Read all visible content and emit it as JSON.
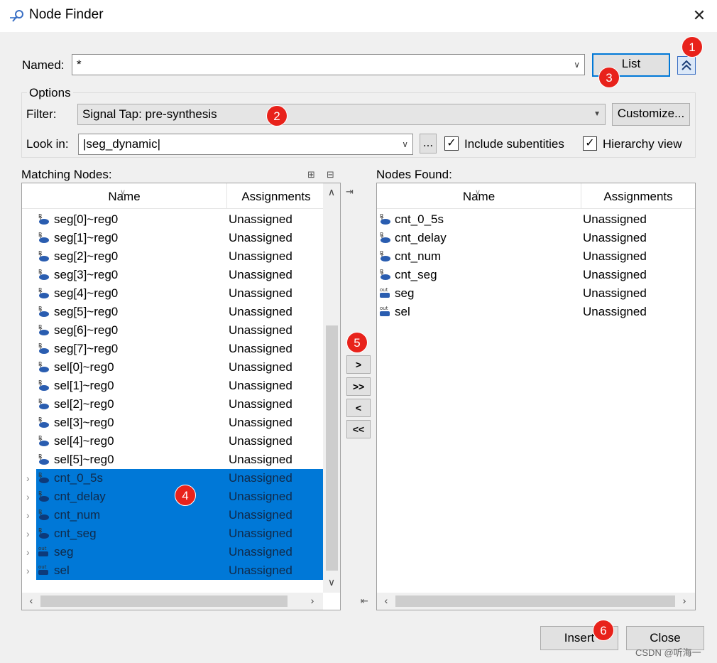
{
  "window": {
    "title": "Node Finder",
    "close_glyph": "✕"
  },
  "named": {
    "label": "Named:",
    "value": "*"
  },
  "list_button": "List",
  "options": {
    "group_label": "Options",
    "filter_label": "Filter:",
    "filter_value": "Signal Tap: pre-synthesis",
    "customize_button": "Customize...",
    "lookin_label": "Look in:",
    "lookin_value": "|seg_dynamic|",
    "browse_button": "...",
    "include_subentities_label": "Include subentities",
    "include_subentities_checked": true,
    "hierarchy_view_label": "Hierarchy view",
    "hierarchy_view_checked": true
  },
  "matching": {
    "title": "Matching Nodes:",
    "col_name": "Name",
    "col_assign": "Assignments",
    "rows": [
      {
        "name": "seg[0]~reg0",
        "assign": "Unassigned"
      },
      {
        "name": "seg[1]~reg0",
        "assign": "Unassigned"
      },
      {
        "name": "seg[2]~reg0",
        "assign": "Unassigned"
      },
      {
        "name": "seg[3]~reg0",
        "assign": "Unassigned"
      },
      {
        "name": "seg[4]~reg0",
        "assign": "Unassigned"
      },
      {
        "name": "seg[5]~reg0",
        "assign": "Unassigned"
      },
      {
        "name": "seg[6]~reg0",
        "assign": "Unassigned"
      },
      {
        "name": "seg[7]~reg0",
        "assign": "Unassigned"
      },
      {
        "name": "sel[0]~reg0",
        "assign": "Unassigned"
      },
      {
        "name": "sel[1]~reg0",
        "assign": "Unassigned"
      },
      {
        "name": "sel[2]~reg0",
        "assign": "Unassigned"
      },
      {
        "name": "sel[3]~reg0",
        "assign": "Unassigned"
      },
      {
        "name": "sel[4]~reg0",
        "assign": "Unassigned"
      },
      {
        "name": "sel[5]~reg0",
        "assign": "Unassigned"
      },
      {
        "name": "cnt_0_5s",
        "assign": "Unassigned"
      },
      {
        "name": "cnt_delay",
        "assign": "Unassigned"
      },
      {
        "name": "cnt_num",
        "assign": "Unassigned"
      },
      {
        "name": "cnt_seg",
        "assign": "Unassigned"
      },
      {
        "name": "seg",
        "assign": "Unassigned"
      },
      {
        "name": "sel",
        "assign": "Unassigned"
      }
    ]
  },
  "found": {
    "title": "Nodes Found:",
    "col_name": "Name",
    "col_assign": "Assignments",
    "rows": [
      {
        "name": "cnt_0_5s",
        "assign": "Unassigned"
      },
      {
        "name": "cnt_delay",
        "assign": "Unassigned"
      },
      {
        "name": "cnt_num",
        "assign": "Unassigned"
      },
      {
        "name": "cnt_seg",
        "assign": "Unassigned"
      },
      {
        "name": "seg",
        "assign": "Unassigned"
      },
      {
        "name": "sel",
        "assign": "Unassigned"
      }
    ]
  },
  "move_buttons": {
    "add": ">",
    "add_all": ">>",
    "remove": "<",
    "remove_all": "<<"
  },
  "insert_button": "Insert",
  "close_button": "Close",
  "badges": [
    "1",
    "2",
    "3",
    "4",
    "5",
    "6"
  ],
  "watermark": "CSDN @听海一",
  "colors": {
    "selection": "#0078d7",
    "badge": "#e8221b",
    "focus": "#0078d7"
  }
}
